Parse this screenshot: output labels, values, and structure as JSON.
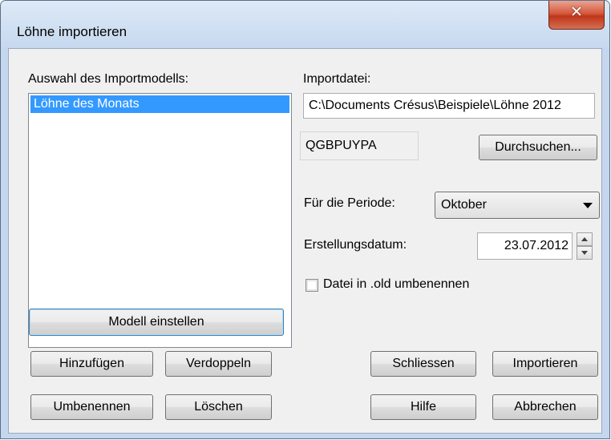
{
  "window": {
    "title": "Löhne importieren",
    "close_icon": "close-icon",
    "close_glyph": "✕"
  },
  "model_selection": {
    "label": "Auswahl des Importmodells:",
    "items": [
      {
        "label": "Löhne des Monats",
        "selected": true
      }
    ],
    "setup_button": "Modell einstellen",
    "add_button": "Hinzufügen",
    "duplicate_button": "Verdoppeln",
    "rename_button": "Umbenennen",
    "delete_button": "Löschen"
  },
  "import_file": {
    "label": "Importdatei:",
    "path": "C:\\Documents Crésus\\Beispiele\\Löhne 2012",
    "code": "QGBPUYPA",
    "browse_button": "Durchsuchen..."
  },
  "period": {
    "label": "Für die Periode:",
    "selected": "Oktober"
  },
  "creation_date": {
    "label": "Erstellungsdatum:",
    "value": "23.07.2012"
  },
  "rename_old": {
    "label": "Datei in .old umbenennen",
    "checked": false
  },
  "actions": {
    "close_button": "Schliessen",
    "import_button": "Importieren",
    "help_button": "Hilfe",
    "cancel_button": "Abbrechen"
  },
  "colors": {
    "selection": "#3399ff",
    "close_button": "#c9452a",
    "frame": "#c4d7ee"
  }
}
